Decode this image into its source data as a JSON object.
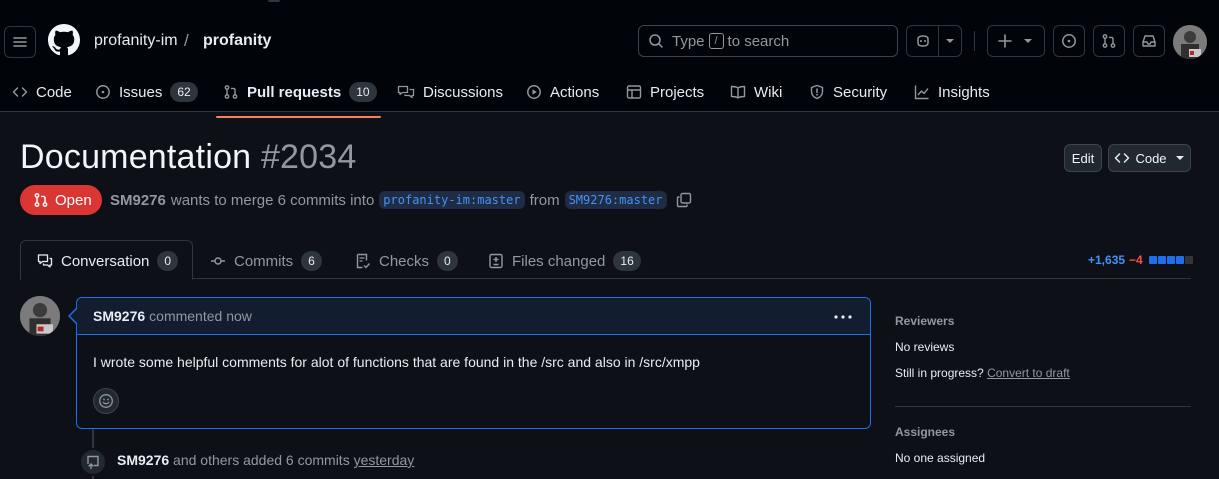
{
  "header": {
    "owner": "profanity-im",
    "separator": "/",
    "repo": "profanity",
    "search": {
      "prefix": "Type",
      "key": "/",
      "suffix": "to search"
    }
  },
  "repo_nav": {
    "items": [
      {
        "label": "Code",
        "icon": "code-icon"
      },
      {
        "label": "Issues",
        "icon": "issue-opened-icon",
        "count": "62"
      },
      {
        "label": "Pull requests",
        "icon": "git-pull-request-icon",
        "count": "10"
      },
      {
        "label": "Discussions",
        "icon": "comment-discussion-icon"
      },
      {
        "label": "Actions",
        "icon": "play-icon"
      },
      {
        "label": "Projects",
        "icon": "table-icon"
      },
      {
        "label": "Wiki",
        "icon": "book-icon"
      },
      {
        "label": "Security",
        "icon": "shield-icon"
      },
      {
        "label": "Insights",
        "icon": "graph-icon"
      }
    ]
  },
  "pr": {
    "title": "Documentation",
    "number": "#2034",
    "edit_label": "Edit",
    "code_label": "Code",
    "state": "Open",
    "author": "SM9276",
    "merge_text": "wants to merge 6 commits into",
    "base_branch": "profanity-im:master",
    "from_text": "from",
    "head_branch": "SM9276:master"
  },
  "tabs": [
    {
      "label": "Conversation",
      "count": "0"
    },
    {
      "label": "Commits",
      "count": "6"
    },
    {
      "label": "Checks",
      "count": "0"
    },
    {
      "label": "Files changed",
      "count": "16"
    }
  ],
  "diffstat": {
    "additions": "+1,635",
    "deletions": "−4"
  },
  "comment": {
    "author": "SM9276",
    "time": "commented now",
    "body": "I wrote some helpful comments for alot of functions that are found in the /src and also in /src/xmpp"
  },
  "timeline_event": {
    "author": "SM9276",
    "text": "and others added 6 commits",
    "time": "yesterday"
  },
  "sidebar": {
    "reviewers_heading": "Reviewers",
    "reviewers_value": "No reviews",
    "in_progress_text": "Still in progress?",
    "convert_link": "Convert to draft",
    "assignees_heading": "Assignees",
    "assignees_value": "No one assigned"
  },
  "colors": {
    "accent_blue": "#1f6feb",
    "open_red": "#da3633",
    "selected_underline": "#f78166"
  }
}
